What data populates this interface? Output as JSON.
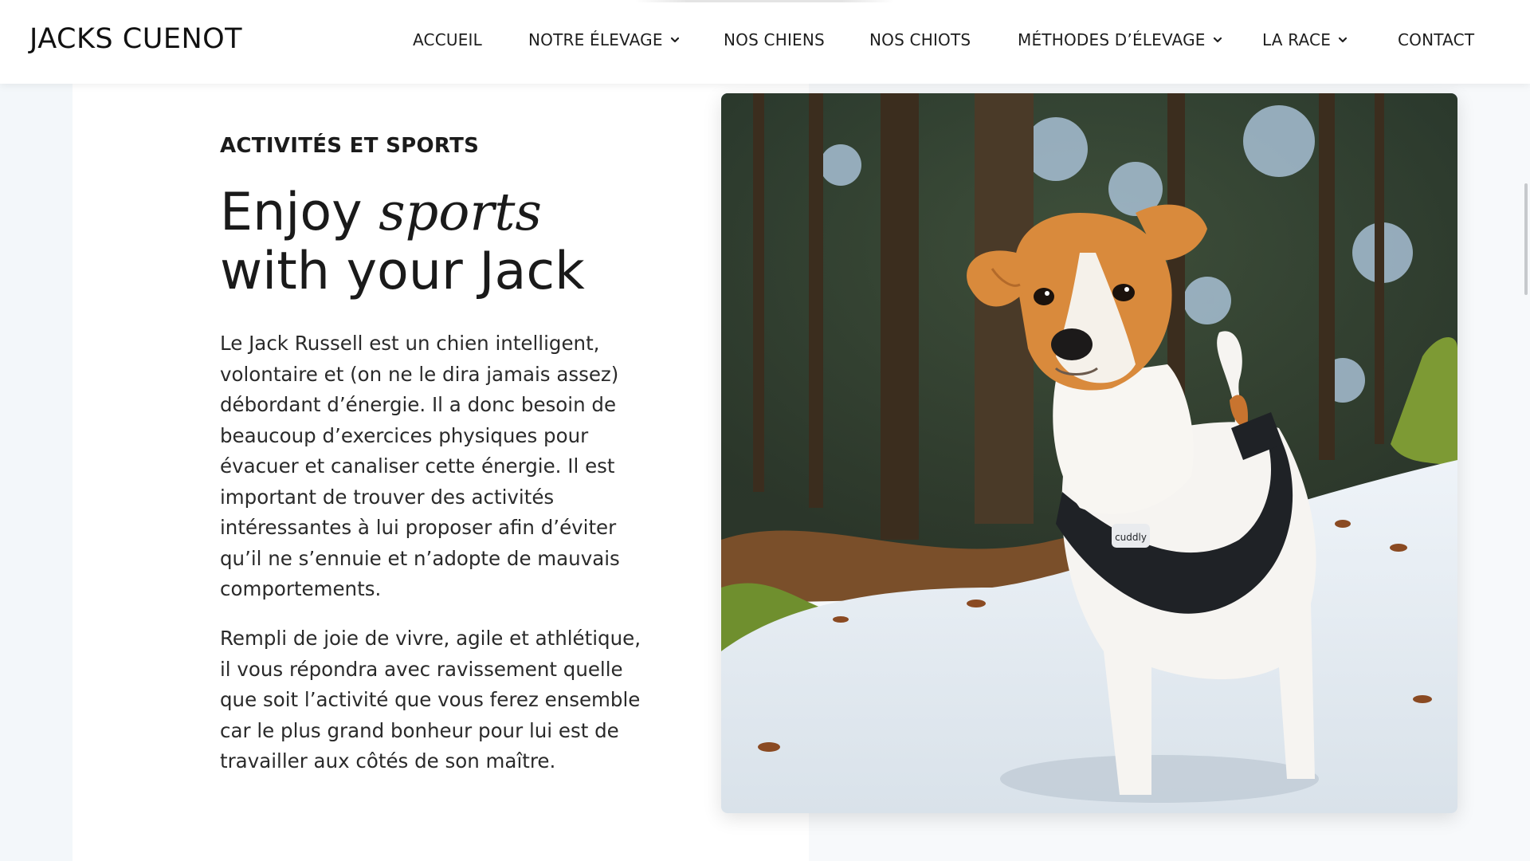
{
  "brand": "JACKS CUENOT",
  "nav": {
    "items": [
      {
        "label": "ACCUEIL"
      },
      {
        "label": "NOTRE ÉLEVAGE"
      },
      {
        "label": "NOS CHIENS"
      },
      {
        "label": "NOS CHIOTS"
      },
      {
        "label": "MÉTHODES D’ÉLEVAGE"
      },
      {
        "label": "LA RACE"
      },
      {
        "label": "CONTACT"
      }
    ]
  },
  "section": {
    "eyebrow": "ACTIVITÉS ET SPORTS",
    "heading_part1": "Enjoy ",
    "heading_em": "sports",
    "heading_part2": " with your Jack",
    "paragraph1": "Le Jack Russell est un chien intelligent, volontaire et (on ne le dira jamais assez) débordant d’énergie. Il a donc besoin de beaucoup d’exercices physiques pour évacuer et canaliser cette énergie. Il est important de trouver des activités intéressantes à lui proposer afin d’éviter qu’il ne s’ennuie et n’adopte de mauvais comportements.",
    "paragraph2": "Rempli de joie de vivre, agile et athlétique, il vous répondra avec ravissement quelle que soit l’activité que vous ferez ensemble car le plus grand bonheur pour lui est de travailler aux côtés de son maître."
  },
  "photo": {
    "harness_text": "cuddly"
  },
  "colors": {
    "page_bg": "#f3f7fa",
    "panel_bg": "#ffffff",
    "text": "#1c1c1c",
    "dog_tan": "#d98a3c"
  },
  "icons": {
    "dropdown": "chevron-down-icon"
  }
}
